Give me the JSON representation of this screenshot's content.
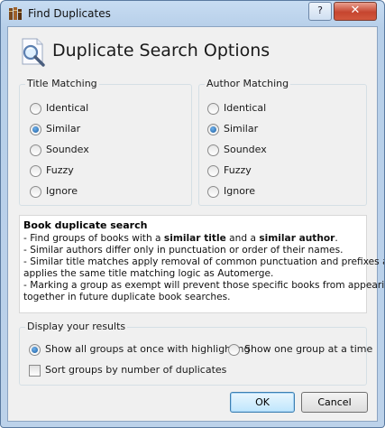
{
  "window": {
    "title": "Find Duplicates",
    "help_label": "?",
    "close_label": "✕"
  },
  "header": {
    "title": "Duplicate Search Options"
  },
  "title_matching": {
    "legend": "Title Matching",
    "options": [
      "Identical",
      "Similar",
      "Soundex",
      "Fuzzy",
      "Ignore"
    ],
    "selected": "Similar"
  },
  "author_matching": {
    "legend": "Author Matching",
    "options": [
      "Identical",
      "Similar",
      "Soundex",
      "Fuzzy",
      "Ignore"
    ],
    "selected": "Similar"
  },
  "description": {
    "heading": "Book duplicate search",
    "line1_a": "- Find groups of books with a ",
    "line1_b": "similar title",
    "line1_c": " and a ",
    "line1_d": "similar author",
    "line1_e": ".",
    "line2": "- Similar authors differ only in punctuation or order of their names.",
    "line3": "- Similar title matches apply removal of common punctuation and prefixes and",
    "line4": "applies the same title matching logic as Automerge.",
    "line5": "- Marking a group as exempt will prevent those specific books from appearing",
    "line6": "together in future duplicate book searches."
  },
  "display": {
    "legend": "Display your results",
    "option_all": "Show all groups at once with highlighting",
    "option_one": "Show one group at a time",
    "selected": "Show all groups at once with highlighting",
    "sort_label": "Sort groups by number of duplicates",
    "sort_checked": false
  },
  "buttons": {
    "ok": "OK",
    "cancel": "Cancel"
  }
}
